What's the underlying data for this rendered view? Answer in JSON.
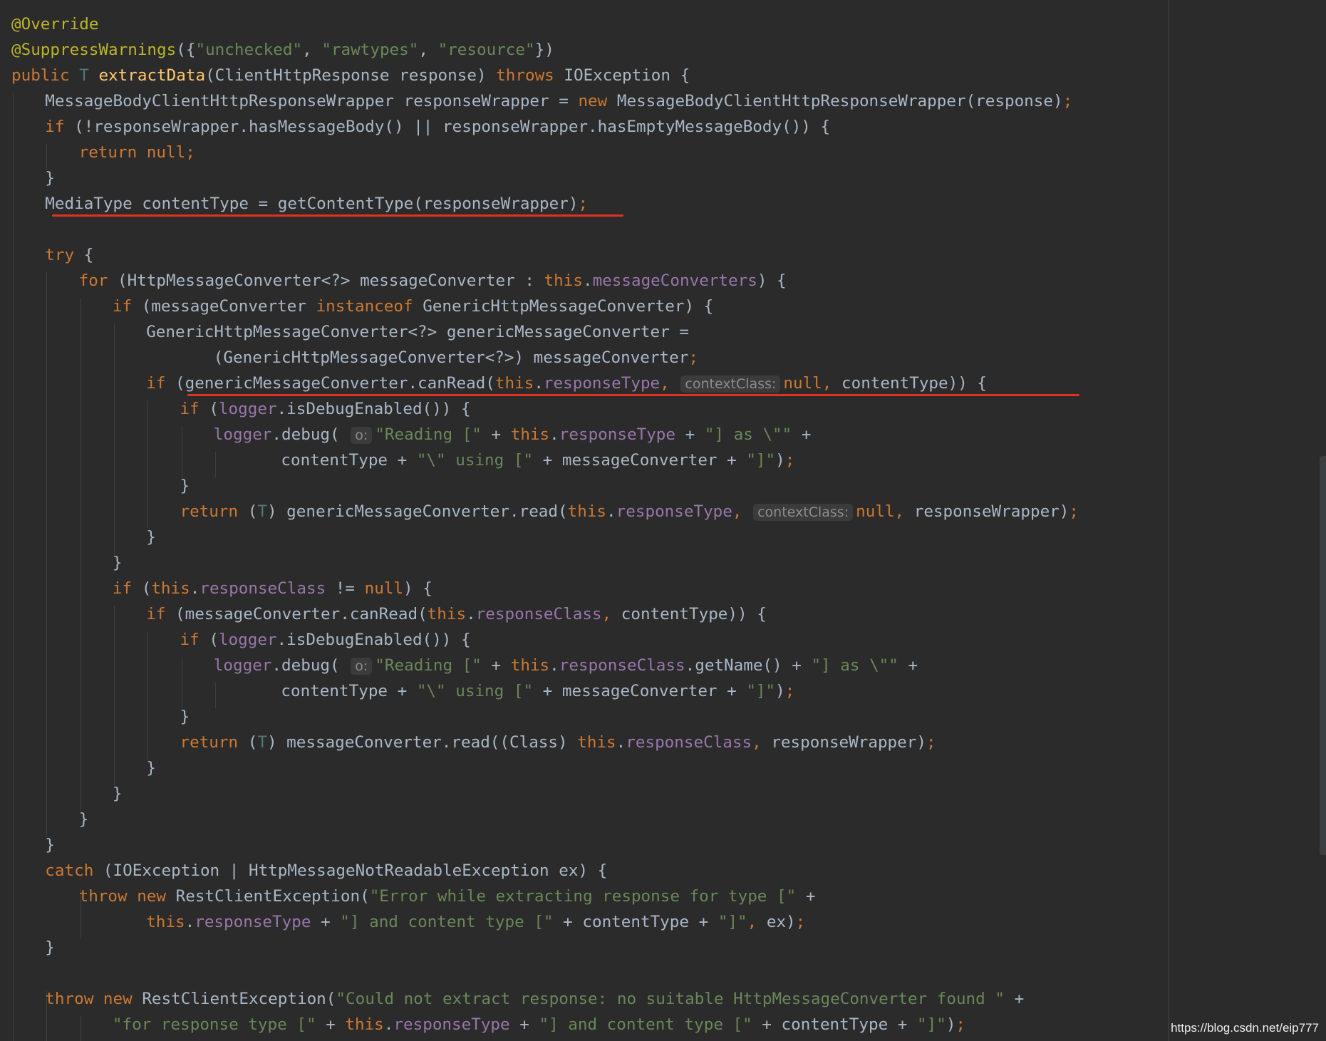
{
  "colors": {
    "background": "#2b2b2b",
    "keyword": "#cc7832",
    "annotation": "#bbb529",
    "string": "#6a8759",
    "method_declaration": "#ffc66d",
    "field": "#9876aa",
    "type_parameter": "#507874",
    "plain": "#a9b7c6",
    "parameter_hint": "#8c8c8c",
    "underline_mark": "#e0321e"
  },
  "watermark": "https://blog.csdn.net/eip777",
  "code": [
    {
      "indent": 0,
      "tokens": [
        [
          "ann",
          "@Override"
        ]
      ]
    },
    {
      "indent": 0,
      "tokens": [
        [
          "ann",
          "@SuppressWarnings"
        ],
        [
          "pl",
          "({"
        ],
        [
          "str",
          "\"unchecked\""
        ],
        [
          "pl",
          ", "
        ],
        [
          "str",
          "\"rawtypes\""
        ],
        [
          "pl",
          ", "
        ],
        [
          "str",
          "\"resource\""
        ],
        [
          "pl",
          "})"
        ]
      ]
    },
    {
      "indent": 0,
      "tokens": [
        [
          "kw",
          "public "
        ],
        [
          "tp",
          "T "
        ],
        [
          "fn",
          "extractData"
        ],
        [
          "pl",
          "(ClientHttpResponse response) "
        ],
        [
          "kw",
          "throws "
        ],
        [
          "pl",
          "IOException {"
        ]
      ]
    },
    {
      "indent": 1,
      "tokens": [
        [
          "pl",
          "MessageBodyClientHttpResponseWrapper responseWrapper = "
        ],
        [
          "kw",
          "new "
        ],
        [
          "pl",
          "MessageBodyClientHttpResponseWrapper(response)"
        ],
        [
          "kw",
          ";"
        ]
      ]
    },
    {
      "indent": 1,
      "tokens": [
        [
          "kw",
          "if "
        ],
        [
          "pl",
          "(!responseWrapper.hasMessageBody() || responseWrapper.hasEmptyMessageBody()) {"
        ]
      ]
    },
    {
      "indent": 2,
      "tokens": [
        [
          "kw",
          "return null;"
        ]
      ]
    },
    {
      "indent": 1,
      "tokens": [
        [
          "pl",
          "}"
        ]
      ]
    },
    {
      "indent": 1,
      "tokens": [
        [
          "pl",
          "MediaType contentType = getContentType(responseWrapper)"
        ],
        [
          "kw",
          ";"
        ]
      ]
    },
    {
      "indent": 0,
      "tokens": []
    },
    {
      "indent": 1,
      "tokens": [
        [
          "kw",
          "try "
        ],
        [
          "pl",
          "{"
        ]
      ]
    },
    {
      "indent": 2,
      "tokens": [
        [
          "kw",
          "for "
        ],
        [
          "pl",
          "(HttpMessageConverter<?> messageConverter : "
        ],
        [
          "kw",
          "this"
        ],
        [
          "pl",
          "."
        ],
        [
          "fld",
          "messageConverters"
        ],
        [
          "pl",
          ") {"
        ]
      ]
    },
    {
      "indent": 3,
      "tokens": [
        [
          "kw",
          "if "
        ],
        [
          "pl",
          "(messageConverter "
        ],
        [
          "kw",
          "instanceof "
        ],
        [
          "pl",
          "GenericHttpMessageConverter) {"
        ]
      ]
    },
    {
      "indent": 4,
      "tokens": [
        [
          "pl",
          "GenericHttpMessageConverter<?> genericMessageConverter ="
        ]
      ]
    },
    {
      "indent": 6,
      "tokens": [
        [
          "pl",
          "(GenericHttpMessageConverter<?>) messageConverter"
        ],
        [
          "kw",
          ";"
        ]
      ]
    },
    {
      "indent": 4,
      "tokens": [
        [
          "kw",
          "if "
        ],
        [
          "pl",
          "(genericMessageConverter.canRead("
        ],
        [
          "kw",
          "this"
        ],
        [
          "pl",
          "."
        ],
        [
          "fld",
          "responseType"
        ],
        [
          "kw",
          ", "
        ],
        [
          "hint",
          "contextClass:"
        ],
        [
          "kw",
          "null, "
        ],
        [
          "pl",
          "contentType)) {"
        ]
      ]
    },
    {
      "indent": 5,
      "tokens": [
        [
          "kw",
          "if "
        ],
        [
          "pl",
          "("
        ],
        [
          "fld",
          "logger"
        ],
        [
          "pl",
          ".isDebugEnabled()) {"
        ]
      ]
    },
    {
      "indent": 6,
      "tokens": [
        [
          "fld",
          "logger"
        ],
        [
          "pl",
          ".debug( "
        ],
        [
          "hint",
          "o:"
        ],
        [
          "str",
          "\"Reading [\" "
        ],
        [
          "pl",
          "+ "
        ],
        [
          "kw",
          "this"
        ],
        [
          "pl",
          "."
        ],
        [
          "fld",
          "responseType "
        ],
        [
          "pl",
          "+ "
        ],
        [
          "str",
          "\"] as \\\"\" "
        ],
        [
          "pl",
          "+"
        ]
      ]
    },
    {
      "indent": 8,
      "tokens": [
        [
          "pl",
          "contentType + "
        ],
        [
          "str",
          "\"\\\" using [\" "
        ],
        [
          "pl",
          "+ messageConverter + "
        ],
        [
          "str",
          "\"]\""
        ],
        [
          "pl",
          ")"
        ],
        [
          "kw",
          ";"
        ]
      ]
    },
    {
      "indent": 5,
      "tokens": [
        [
          "pl",
          "}"
        ]
      ]
    },
    {
      "indent": 5,
      "tokens": [
        [
          "kw",
          "return "
        ],
        [
          "pl",
          "("
        ],
        [
          "tp",
          "T"
        ],
        [
          "pl",
          ") genericMessageConverter.read("
        ],
        [
          "kw",
          "this"
        ],
        [
          "pl",
          "."
        ],
        [
          "fld",
          "responseType"
        ],
        [
          "kw",
          ", "
        ],
        [
          "hint",
          "contextClass:"
        ],
        [
          "kw",
          "null, "
        ],
        [
          "pl",
          "responseWrapper)"
        ],
        [
          "kw",
          ";"
        ]
      ]
    },
    {
      "indent": 4,
      "tokens": [
        [
          "pl",
          "}"
        ]
      ]
    },
    {
      "indent": 3,
      "tokens": [
        [
          "pl",
          "}"
        ]
      ]
    },
    {
      "indent": 3,
      "tokens": [
        [
          "kw",
          "if "
        ],
        [
          "pl",
          "("
        ],
        [
          "kw",
          "this"
        ],
        [
          "pl",
          "."
        ],
        [
          "fld",
          "responseClass "
        ],
        [
          "pl",
          "!= "
        ],
        [
          "kw",
          "null"
        ],
        [
          "pl",
          ") {"
        ]
      ]
    },
    {
      "indent": 4,
      "tokens": [
        [
          "kw",
          "if "
        ],
        [
          "pl",
          "(messageConverter.canRead("
        ],
        [
          "kw",
          "this"
        ],
        [
          "pl",
          "."
        ],
        [
          "fld",
          "responseClass"
        ],
        [
          "kw",
          ", "
        ],
        [
          "pl",
          "contentType)) {"
        ]
      ]
    },
    {
      "indent": 5,
      "tokens": [
        [
          "kw",
          "if "
        ],
        [
          "pl",
          "("
        ],
        [
          "fld",
          "logger"
        ],
        [
          "pl",
          ".isDebugEnabled()) {"
        ]
      ]
    },
    {
      "indent": 6,
      "tokens": [
        [
          "fld",
          "logger"
        ],
        [
          "pl",
          ".debug( "
        ],
        [
          "hint",
          "o:"
        ],
        [
          "str",
          "\"Reading [\" "
        ],
        [
          "pl",
          "+ "
        ],
        [
          "kw",
          "this"
        ],
        [
          "pl",
          "."
        ],
        [
          "fld",
          "responseClass"
        ],
        [
          "pl",
          ".getName() + "
        ],
        [
          "str",
          "\"] as \\\"\" "
        ],
        [
          "pl",
          "+"
        ]
      ]
    },
    {
      "indent": 8,
      "tokens": [
        [
          "pl",
          "contentType + "
        ],
        [
          "str",
          "\"\\\" using [\" "
        ],
        [
          "pl",
          "+ messageConverter + "
        ],
        [
          "str",
          "\"]\""
        ],
        [
          "pl",
          ")"
        ],
        [
          "kw",
          ";"
        ]
      ]
    },
    {
      "indent": 5,
      "tokens": [
        [
          "pl",
          "}"
        ]
      ]
    },
    {
      "indent": 5,
      "tokens": [
        [
          "kw",
          "return "
        ],
        [
          "pl",
          "("
        ],
        [
          "tp",
          "T"
        ],
        [
          "pl",
          ") messageConverter.read((Class) "
        ],
        [
          "kw",
          "this"
        ],
        [
          "pl",
          "."
        ],
        [
          "fld",
          "responseClass"
        ],
        [
          "kw",
          ", "
        ],
        [
          "pl",
          "responseWrapper)"
        ],
        [
          "kw",
          ";"
        ]
      ]
    },
    {
      "indent": 4,
      "tokens": [
        [
          "pl",
          "}"
        ]
      ]
    },
    {
      "indent": 3,
      "tokens": [
        [
          "pl",
          "}"
        ]
      ]
    },
    {
      "indent": 2,
      "tokens": [
        [
          "pl",
          "}"
        ]
      ]
    },
    {
      "indent": 1,
      "tokens": [
        [
          "pl",
          "}"
        ]
      ]
    },
    {
      "indent": 1,
      "tokens": [
        [
          "kw",
          "catch "
        ],
        [
          "pl",
          "(IOException | HttpMessageNotReadableException ex) {"
        ]
      ]
    },
    {
      "indent": 2,
      "tokens": [
        [
          "kw",
          "throw new "
        ],
        [
          "pl",
          "RestClientException("
        ],
        [
          "str",
          "\"Error while extracting response for type [\" "
        ],
        [
          "pl",
          "+"
        ]
      ]
    },
    {
      "indent": 4,
      "tokens": [
        [
          "kw",
          "this"
        ],
        [
          "pl",
          "."
        ],
        [
          "fld",
          "responseType "
        ],
        [
          "pl",
          "+ "
        ],
        [
          "str",
          "\"] and content type [\" "
        ],
        [
          "pl",
          "+ contentType + "
        ],
        [
          "str",
          "\"]\""
        ],
        [
          "kw",
          ", "
        ],
        [
          "pl",
          "ex)"
        ],
        [
          "kw",
          ";"
        ]
      ]
    },
    {
      "indent": 1,
      "tokens": [
        [
          "pl",
          "}"
        ]
      ]
    },
    {
      "indent": 0,
      "tokens": []
    },
    {
      "indent": 1,
      "tokens": [
        [
          "kw",
          "throw new "
        ],
        [
          "pl",
          "RestClientException("
        ],
        [
          "str",
          "\"Could not extract response: no suitable HttpMessageConverter found \" "
        ],
        [
          "pl",
          "+"
        ]
      ]
    },
    {
      "indent": 3,
      "tokens": [
        [
          "str",
          "\"for response type [\" "
        ],
        [
          "pl",
          "+ "
        ],
        [
          "kw",
          "this"
        ],
        [
          "pl",
          "."
        ],
        [
          "fld",
          "responseType "
        ],
        [
          "pl",
          "+ "
        ],
        [
          "str",
          "\"] and content type [\" "
        ],
        [
          "pl",
          "+ contentType + "
        ],
        [
          "str",
          "\"]\""
        ],
        [
          "pl",
          ")"
        ],
        [
          "kw",
          ";"
        ]
      ]
    }
  ]
}
